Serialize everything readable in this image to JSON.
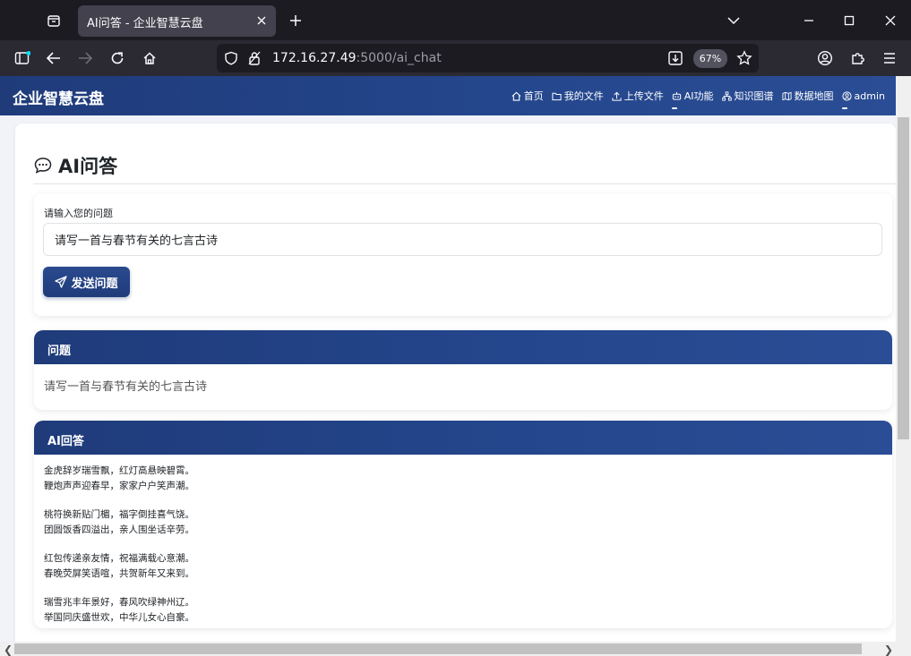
{
  "browser": {
    "tab_title": "AI问答 - 企业智慧云盘",
    "url_host": "172.16.27.49",
    "url_path": ":5000/ai_chat",
    "zoom": "67%"
  },
  "site": {
    "brand": "企业智慧云盘",
    "nav": [
      {
        "label": "首页",
        "icon": "home-icon"
      },
      {
        "label": "我的文件",
        "icon": "folder-icon"
      },
      {
        "label": "上传文件",
        "icon": "upload-icon"
      },
      {
        "label": "AI功能",
        "icon": "robot-icon"
      },
      {
        "label": "知识图谱",
        "icon": "diagram-icon"
      },
      {
        "label": "数据地图",
        "icon": "map-icon"
      },
      {
        "label": "admin",
        "icon": "user-icon"
      }
    ]
  },
  "page": {
    "title": "AI问答",
    "input_label": "请输入您的问题",
    "input_value": "请写一首与春节有关的七言古诗",
    "send_label": "发送问题",
    "question_header": "问题",
    "question_text": "请写一首与春节有关的七言古诗",
    "answer_header": "AI回答",
    "answer_stanzas": [
      [
        "金虎辞岁瑞雪飘，红灯高悬映碧霄。",
        "鞭炮声声迎春早，家家户户笑声潮。"
      ],
      [
        "桃符换新贴门楣，福字倒挂喜气饶。",
        "团圆饭香四溢出，亲人围坐话辛劳。"
      ],
      [
        "红包传递亲友情，祝福满载心意潮。",
        "春晚荧屏笑语喧，共贺新年又来到。"
      ],
      [
        "瑞雪兆丰年景好，春风吹绿神州辽。",
        "举国同庆盛世欢，中华儿女心自豪。"
      ]
    ]
  },
  "colors": {
    "brand_blue": "#1f3b7a",
    "brand_blue_light": "#2a4d95",
    "page_bg": "#f1f3f8",
    "chrome_dark": "#1c1b22"
  }
}
